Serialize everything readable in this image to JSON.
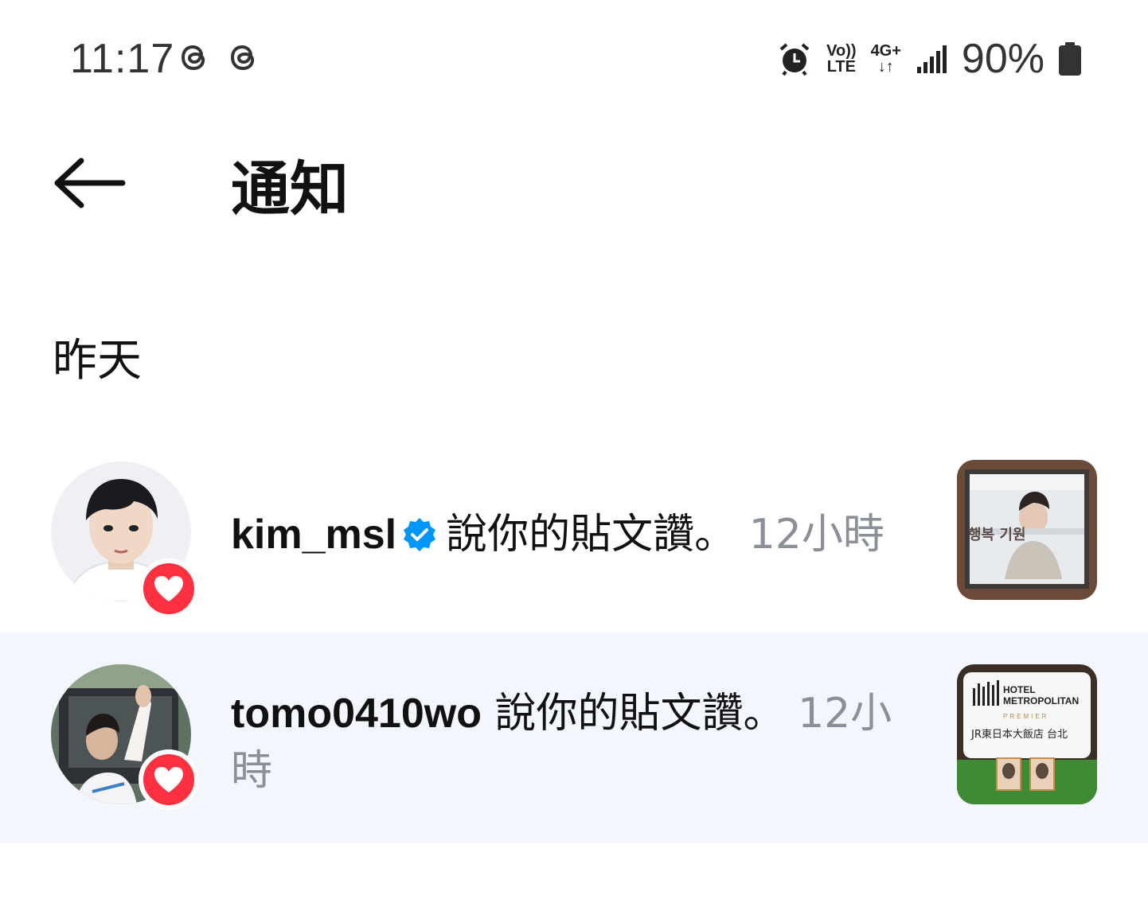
{
  "status_bar": {
    "time": "11:17",
    "volte_top": "Vo))",
    "volte_bottom": "LTE",
    "network": "4G+",
    "battery": "90%"
  },
  "header": {
    "title": "通知"
  },
  "section": {
    "title": "昨天"
  },
  "notifications": [
    {
      "username": "kim_msl",
      "verified": true,
      "action": "說你的貼文讚。",
      "time": "12小時"
    },
    {
      "username": "tomo0410wo",
      "verified": false,
      "action": "說你的貼文讚。",
      "time": "12小時"
    }
  ],
  "thumbnails": {
    "poster_text": "행복 기원",
    "hotel_name": "HOTEL\nMETROPOLITAN",
    "hotel_sub": "PREMIER",
    "hotel_city": "JR東日本大飯店 台北"
  },
  "colors": {
    "like": "#ff3040",
    "verified": "#0095f6",
    "secondary_text": "#8a8f98",
    "highlight_row": "#f3f6fc"
  }
}
